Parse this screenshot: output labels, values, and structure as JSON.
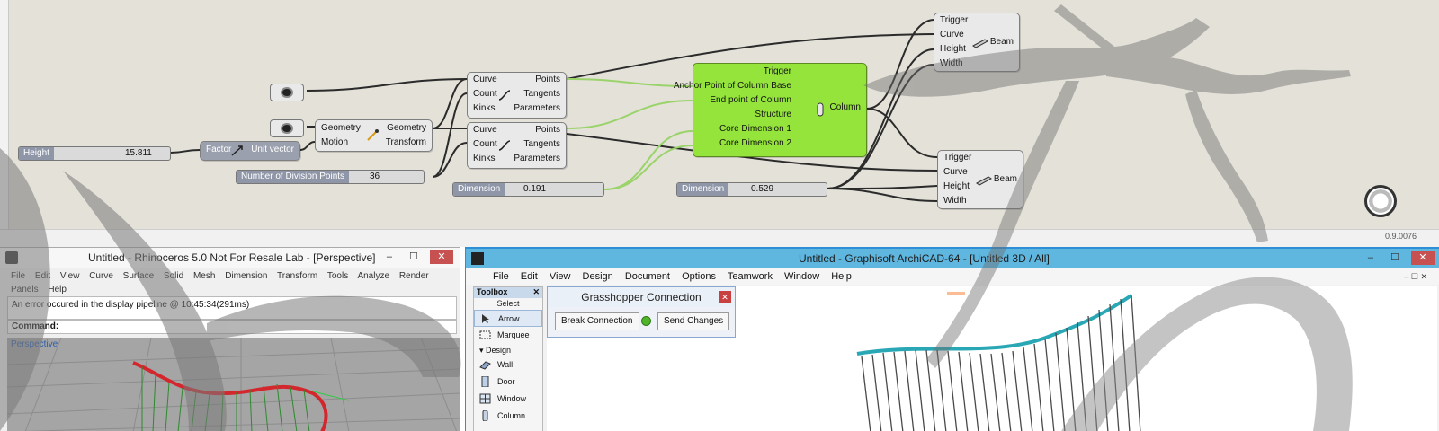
{
  "grasshopper": {
    "zoom_label": "0.9.0076",
    "sliders": {
      "height": {
        "label": "Height",
        "value": "15.811"
      },
      "division": {
        "label": "Number of Division Points",
        "value": "36"
      },
      "dimension1": {
        "label": "Dimension",
        "value": "0.191"
      },
      "dimension2": {
        "label": "Dimension",
        "value": "0.529"
      }
    },
    "unit_vector": {
      "inputs": [
        "Factor"
      ],
      "outputs": [
        "Unit vector"
      ]
    },
    "move": {
      "inputs": [
        "Geometry",
        "Motion"
      ],
      "outputs": [
        "Geometry",
        "Transform"
      ]
    },
    "divide_top": {
      "inputs": [
        "Curve",
        "Count",
        "Kinks"
      ],
      "outputs": [
        "Points",
        "Tangents",
        "Parameters"
      ]
    },
    "divide_bottom": {
      "inputs": [
        "Curve",
        "Count",
        "Kinks"
      ],
      "outputs": [
        "Points",
        "Tangents",
        "Parameters"
      ]
    },
    "column": {
      "inputs": [
        "Trigger",
        "Anchor Point of Column Base",
        "End point of Column",
        "Structure",
        "Core Dimension 1",
        "Core Dimension 2"
      ],
      "outputs": [
        "Column"
      ]
    },
    "beam_top": {
      "inputs": [
        "Trigger",
        "Curve",
        "Height",
        "Width"
      ],
      "outputs": [
        "Beam"
      ]
    },
    "beam_bottom": {
      "inputs": [
        "Trigger",
        "Curve",
        "Height",
        "Width"
      ],
      "outputs": [
        "Beam"
      ]
    },
    "icons": {
      "curve_param_1": "curve-param-icon",
      "curve_param_2": "curve-param-icon",
      "unit_vector": "unit-vector-icon",
      "move": "move-icon",
      "divide": "divide-curve-icon",
      "column": "column-icon",
      "beam": "beam-icon",
      "compass": "navigation-compass-icon"
    }
  },
  "rhino": {
    "title": "Untitled - Rhinoceros 5.0 Not For Resale Lab - [Perspective]",
    "menu": [
      "File",
      "Edit",
      "View",
      "Curve",
      "Surface",
      "Solid",
      "Mesh",
      "Dimension",
      "Transform",
      "Tools",
      "Analyze",
      "Render",
      "Panels",
      "Help"
    ],
    "history": "An error occured in the display pipeline @ 10:45:34(291ms)",
    "command_label": "Command:",
    "viewport_label": "Perspective"
  },
  "archicad": {
    "title": "Untitled - Graphisoft ArchiCAD-64 - [Untitled 3D / All]",
    "menu": [
      "File",
      "Edit",
      "View",
      "Design",
      "Document",
      "Options",
      "Teamwork",
      "Window",
      "Help"
    ],
    "toolbox": {
      "title": "Toolbox",
      "select_label": "Select",
      "tools": [
        "Arrow",
        "Marquee"
      ],
      "group": "Design",
      "design_tools": [
        "Wall",
        "Door",
        "Window",
        "Column"
      ]
    },
    "gh_connection": {
      "title": "Grasshopper Connection",
      "break_label": "Break Connection",
      "send_label": "Send Changes"
    }
  },
  "colors": {
    "canvas": "#e3e1d8",
    "column_node": "#95e43b",
    "slider_label": "#8e96a8",
    "archicad_title": "#5fb7e0",
    "column_geometry": "#2aa7b5"
  }
}
